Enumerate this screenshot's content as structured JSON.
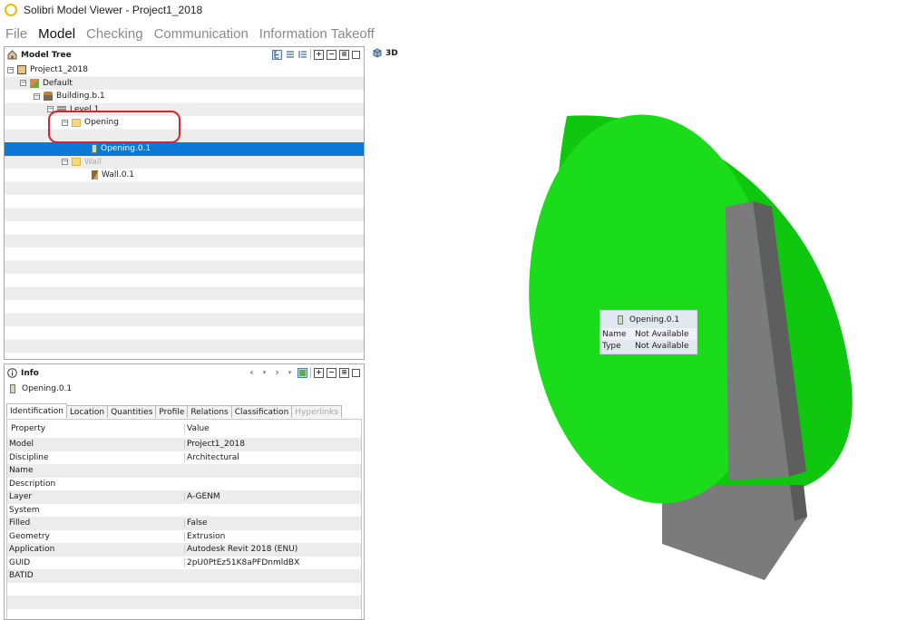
{
  "window": {
    "title": "Solibri Model Viewer - Project1_2018"
  },
  "menu": [
    "File",
    "Model",
    "Checking",
    "Communication",
    "Information Takeoff"
  ],
  "model_tree": {
    "title": "Model Tree",
    "nodes": [
      {
        "label": "Project1_2018",
        "icon": "building-icon",
        "expander": "−"
      },
      {
        "label": "Default",
        "icon": "model-icon",
        "expander": "−"
      },
      {
        "label": "Building.b.1",
        "icon": "house-icon",
        "expander": "−"
      },
      {
        "label": "Level 1",
        "icon": "level-icon",
        "expander": "−"
      },
      {
        "label": "Opening",
        "icon": "folder-icon",
        "expander": "−"
      },
      {
        "label": "Opening.0.1",
        "icon": "opening-icon"
      },
      {
        "label": "Wall",
        "icon": "folder-icon",
        "expander": "−"
      },
      {
        "label": "Wall.0.1",
        "icon": "wall-icon"
      }
    ]
  },
  "info": {
    "title": "Info",
    "object": "Opening.0.1",
    "tabs": [
      "Identification",
      "Location",
      "Quantities",
      "Profile",
      "Relations",
      "Classification",
      "Hyperlinks"
    ],
    "active_tab": "Identification",
    "columns": [
      "Property",
      "Value"
    ],
    "rows": [
      [
        "Model",
        "Project1_2018"
      ],
      [
        "Discipline",
        "Architectural"
      ],
      [
        "Name",
        ""
      ],
      [
        "Description",
        ""
      ],
      [
        "Layer",
        "A-GENM"
      ],
      [
        "System",
        ""
      ],
      [
        "Filled",
        "False"
      ],
      [
        "Geometry",
        "Extrusion"
      ],
      [
        "Application",
        "Autodesk Revit 2018 (ENU)"
      ],
      [
        "GUID",
        "2pU0PtEz51K8aPFDnmldBX"
      ],
      [
        "BATID",
        ""
      ]
    ]
  },
  "view3d": {
    "label": "3D",
    "tooltip": {
      "title": "Opening.0.1",
      "rows": [
        [
          "Name",
          "Not Available"
        ],
        [
          "Type",
          "Not Available"
        ]
      ]
    }
  },
  "colors": {
    "selection": "#0a78d4",
    "cylinder_face": "#1adc1a",
    "cylinder_side": "#0fc70f",
    "wall": "#7b7b7b",
    "annotation": "#d8232a"
  }
}
